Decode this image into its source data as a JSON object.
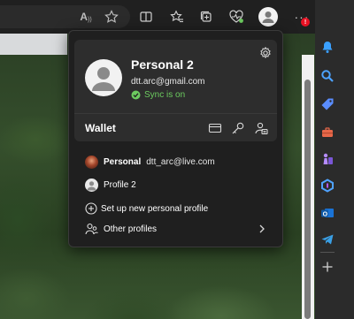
{
  "toolbar": {
    "read_aloud_label": "A",
    "icons": [
      "read-aloud-icon",
      "favorite-star-icon",
      "split-screen-icon",
      "favorites-icon",
      "collections-icon",
      "browser-essentials-icon",
      "profile-avatar-icon",
      "more-options-icon",
      "copilot-icon"
    ]
  },
  "profile_card": {
    "name": "Personal 2",
    "email": "dtt.arc@gmail.com",
    "sync_status": "Sync is on"
  },
  "wallet": {
    "label": "Wallet"
  },
  "profiles": [
    {
      "name": "Personal",
      "email": "dtt_arc@live.com"
    },
    {
      "name": "Profile 2"
    }
  ],
  "actions": {
    "set_up_new": "Set up new personal profile",
    "other_profiles": "Other profiles"
  },
  "sidebar": {
    "icons": [
      "notification-bell-icon",
      "search-icon",
      "shopping-tag-icon",
      "tools-briefcase-icon",
      "games-chess-icon",
      "microsoft365-icon",
      "outlook-icon",
      "telegram-icon",
      "add-icon"
    ]
  },
  "colors": {
    "accent_sync": "#6ccb5f",
    "panel_bg": "#1f1f1f",
    "card_bg": "#2d2d2d",
    "alert_badge": "#e81123"
  }
}
